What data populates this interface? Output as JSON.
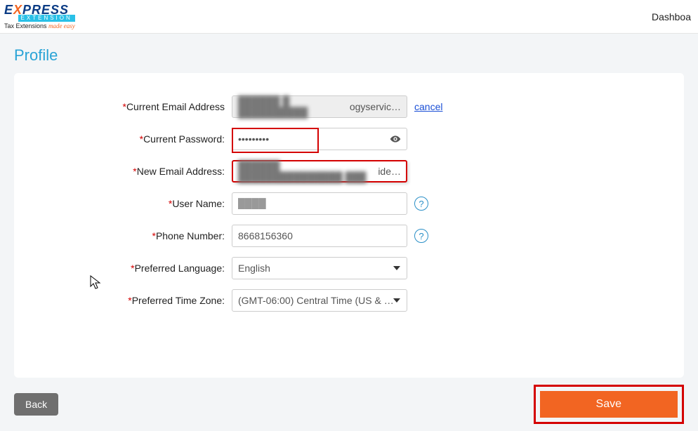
{
  "header": {
    "logo_text": "EXPRESS",
    "logo_sub": "EXTENSION",
    "tagline_prefix": "Tax Extensions ",
    "tagline_suffix": "made easy",
    "nav_dashboard": "Dashboa"
  },
  "page": {
    "title": "Profile"
  },
  "form": {
    "current_email_label": "Current Email Address",
    "current_email_value_blurred": "██████ █ ██████████",
    "current_email_value_tail": "ogyservic…",
    "cancel_link": "cancel",
    "current_password_label": "Current Password:",
    "current_password_value": "●●●●●●●●●",
    "new_email_label": "New Email Address:",
    "new_email_value_blurred": "██████ ███████████████ ███",
    "new_email_value_tail": "ide…",
    "username_label": "User Name:",
    "username_value": "████",
    "phone_label": "Phone Number:",
    "phone_value": "8668156360",
    "language_label": "Preferred Language:",
    "language_value": "English",
    "timezone_label": "Preferred Time Zone:",
    "timezone_value": "(GMT-06:00) Central Time (US & …"
  },
  "buttons": {
    "back": "Back",
    "save": "Save"
  }
}
